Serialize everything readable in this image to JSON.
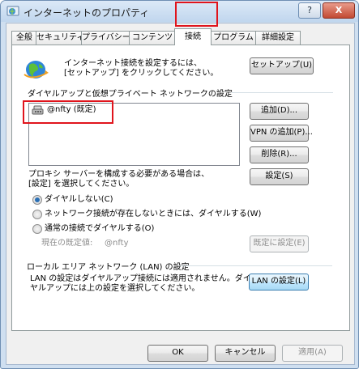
{
  "window": {
    "title": "インターネットのプロパティ",
    "help_label": "?",
    "close_label": "X"
  },
  "tabs": [
    "全般",
    "セキュリティ",
    "プライバシー",
    "コンテンツ",
    "接続",
    "プログラム",
    "詳細設定"
  ],
  "setup": {
    "description_line1": "インターネット接続を設定するには、",
    "description_line2": "[セットアップ] をクリックしてください。",
    "setup_button": "セットアップ(U)"
  },
  "dialup": {
    "section_title": "ダイヤルアップと仮想プライベート ネットワークの設定",
    "connections": [
      {
        "label": "@nfty (既定)"
      }
    ],
    "add_button": "追加(D)...",
    "add_vpn_button": "VPN の追加(P)...",
    "remove_button": "削除(R)...",
    "settings_button": "設定(S)",
    "proxy_line1": "プロキシ サーバーを構成する必要がある場合は、",
    "proxy_line2": "[設定] を選択してください。",
    "radio_never": "ダイヤルしない(C)",
    "radio_no_network": "ネットワーク接続が存在しないときには、ダイヤルする(W)",
    "radio_always": "通常の接続でダイヤルする(O)",
    "selected_option": "ダイヤルしない(C)",
    "current_default_label": "現在の既定値:",
    "current_default_value": "@nfty",
    "set_default_button": "既定に設定(E)"
  },
  "lan": {
    "section_title": "ローカル エリア ネットワーク (LAN) の設定",
    "note_line1": "LAN の設定はダイヤルアップ接続には適用されません。ダイ",
    "note_line2": "ヤルアップには上の設定を選択してください。",
    "lan_settings_button": "LAN の設定(L)"
  },
  "footer": {
    "ok_button": "OK",
    "cancel_button": "キャンセル",
    "apply_button": "適用(A)"
  },
  "colors": {
    "highlight": "#e0141c",
    "radio_selected": "#2a6fb5"
  }
}
